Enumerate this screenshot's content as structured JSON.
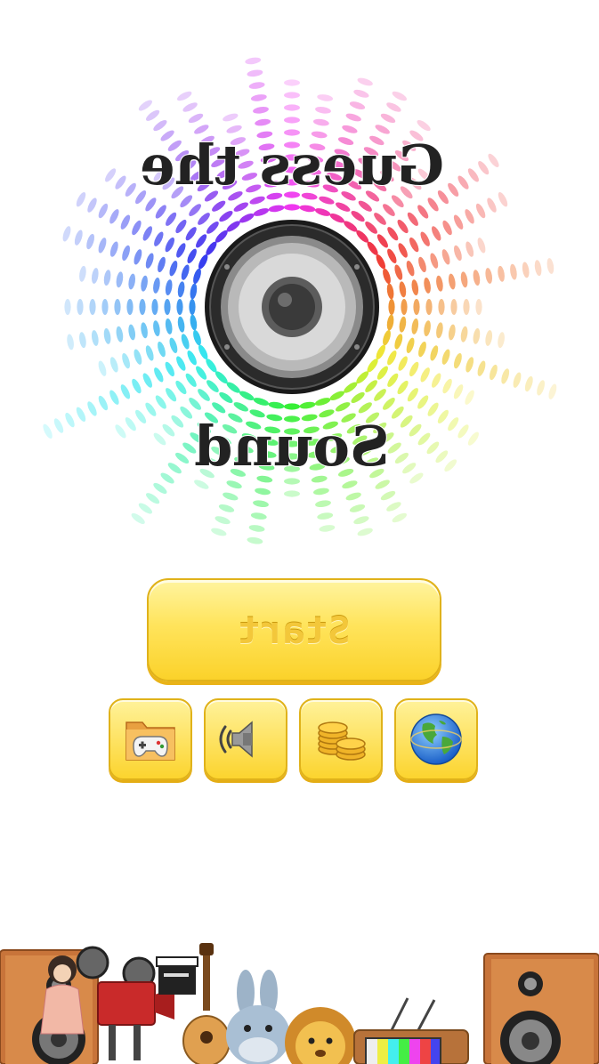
{
  "logo": {
    "title_line1": "Guess the",
    "title_line2": "Sound"
  },
  "start_button": {
    "label": "Start"
  },
  "menu_buttons": [
    {
      "icon": "gamepad-folder-icon"
    },
    {
      "icon": "speaker-sound-icon"
    },
    {
      "icon": "coins-icon"
    },
    {
      "icon": "globe-icon"
    }
  ],
  "colors": {
    "button_fill": "#fcd42e",
    "button_border": "#e0b21a",
    "title_text": "#222222",
    "background": "#ffffff"
  }
}
